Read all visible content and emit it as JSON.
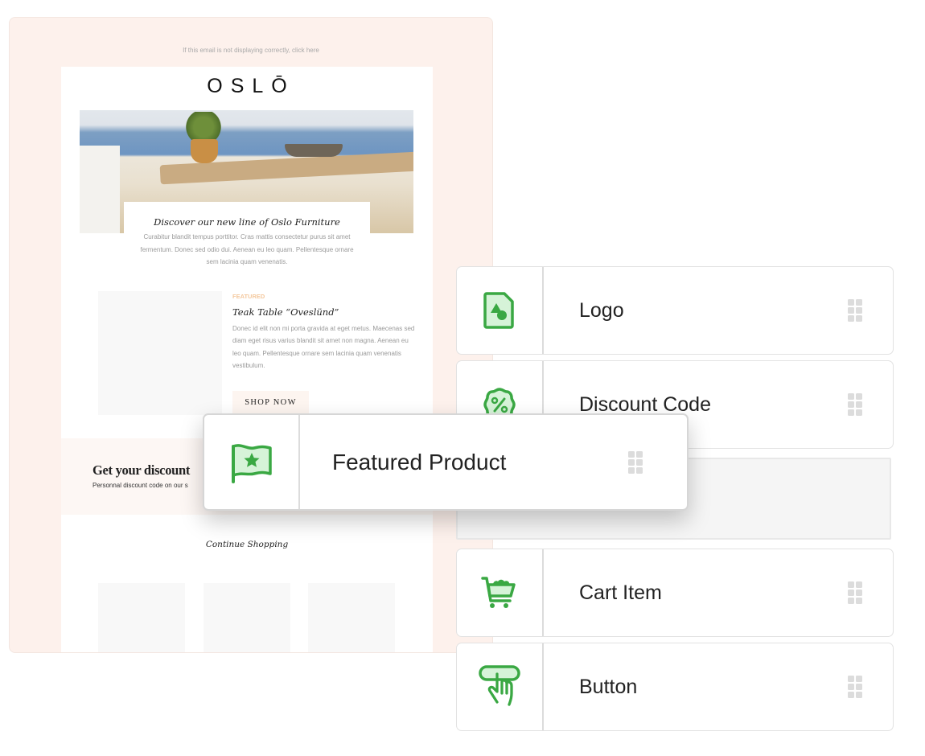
{
  "email": {
    "preheader": "If this email is not displaying correctly, click here",
    "logo": "OSLŌ",
    "hero_caption_title": "Discover our new line of Oslo Furniture",
    "hero_caption_body": "Curabitur blandit tempus porttitor. Cras mattis consectetur purus sit amet fermentum. Donec sed odio dui. Aenean eu leo quam. Pellentesque ornare sem lacinia quam venenatis.",
    "product": {
      "tag": "FEATURED",
      "title": "Teak Table “Oveslünd”",
      "body": "Donec id elit non mi porta gravida at eget metus. Maecenas sed diam eget risus varius blandit sit amet non magna. Aenean eu leo quam. Pellentesque ornare sem lacinia quam venenatis vestibulum.",
      "cta": "SHOP NOW"
    },
    "discount": {
      "title": "Get your discount",
      "subtitle": "Personnal discount code on our s"
    },
    "continue": "Continue Shopping"
  },
  "blocks": [
    {
      "label": "Logo",
      "icon": "logo-file-icon"
    },
    {
      "label": "Discount Code",
      "icon": "discount-badge-icon"
    },
    {
      "label": "Cart Item",
      "icon": "cart-icon"
    },
    {
      "label": "Button",
      "icon": "button-tap-icon"
    }
  ],
  "dragging_block": {
    "label": "Featured Product",
    "icon": "flag-star-icon"
  },
  "colors": {
    "accent": "#3aa843",
    "accent_light": "#d6f3d8",
    "email_bg": "#fdf1ec"
  }
}
